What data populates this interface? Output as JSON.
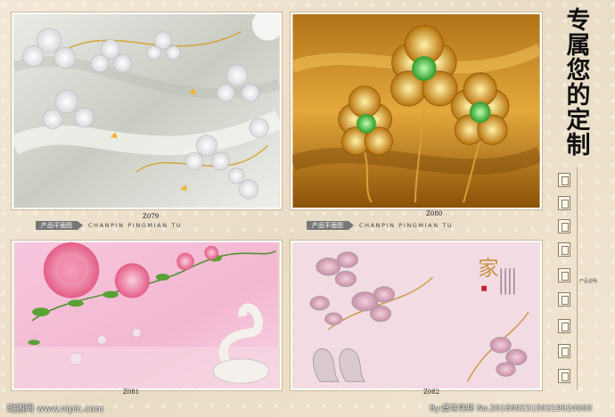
{
  "side_title": [
    "专",
    "属",
    "您",
    "的",
    "定",
    "制"
  ],
  "tiles": [
    {
      "code": "Z079"
    },
    {
      "code": "Z080"
    },
    {
      "code": "Z081"
    },
    {
      "code": "Z082"
    }
  ],
  "banner": {
    "cn": "产品平面图",
    "en": "CHANPIN PINGMIAN TU"
  },
  "side_note": "产品说明",
  "watermark": {
    "left": "昵图网 www.nipic.com",
    "right": "By:盛世伟邦 No.20180923150319024000"
  }
}
